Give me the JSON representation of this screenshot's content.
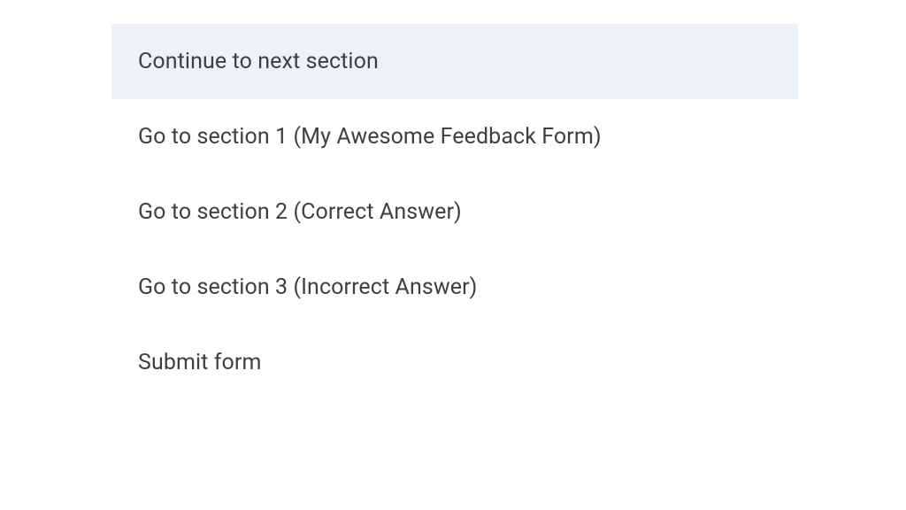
{
  "menu": {
    "items": [
      {
        "label": "Continue to next section",
        "selected": true
      },
      {
        "label": "Go to section 1 (My Awesome Feedback Form)",
        "selected": false
      },
      {
        "label": "Go to section 2 (Correct Answer)",
        "selected": false
      },
      {
        "label": "Go to section 3 (Incorrect Answer)",
        "selected": false
      },
      {
        "label": "Submit form",
        "selected": false
      }
    ]
  }
}
